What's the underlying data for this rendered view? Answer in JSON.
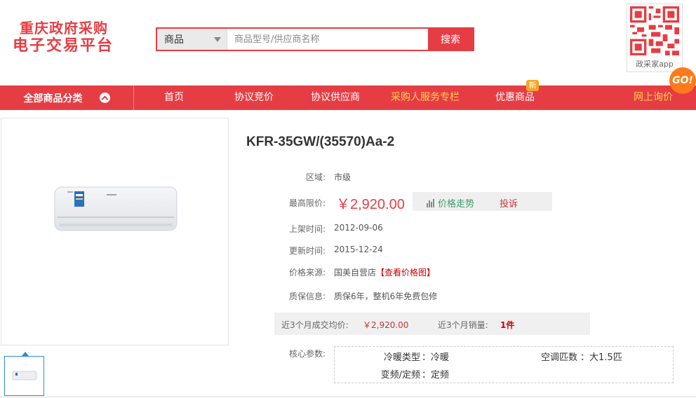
{
  "logo": {
    "line1": "重庆政府采购",
    "line2": "电子交易平台"
  },
  "search": {
    "category": "商品",
    "placeholder": "商品型号/供应商名称",
    "button": "搜索"
  },
  "qr": {
    "caption": "政采家app"
  },
  "nav": {
    "all_categories": "全部商品分类",
    "items": [
      "首页",
      "协议竞价",
      "协议供应商",
      "采购人服务专栏",
      "优惠商品",
      "网上询价"
    ],
    "new_badge": "新",
    "go_badge": "GO!"
  },
  "product": {
    "title": "KFR-35GW/(35570)Aa-2",
    "region_label": "区域:",
    "region": "市级",
    "max_price_label": "最高限价:",
    "max_price": "￥2,920.00",
    "price_trend": "价格走势",
    "complaint": "投诉",
    "listed_label": "上架时间:",
    "listed": "2012-09-06",
    "updated_label": "更新时间:",
    "updated": "2015-12-24",
    "source_label": "价格来源:",
    "source": "国美自营店",
    "source_link": "【查看价格图】",
    "warranty_label": "质保信息:",
    "warranty": "质保6年，整机6年免费包修",
    "avg_price_label": "近3个月成交均价:",
    "avg_price": "￥2,920.00",
    "sales_label": "近3个月销量:",
    "sales": "1件",
    "core_label": "核心参数:",
    "specs": [
      {
        "k": "冷暖类型",
        "v": "冷暖"
      },
      {
        "k": "空调匹数",
        "v": "大1.5匹"
      },
      {
        "k": "变频/定频",
        "v": "定频"
      }
    ]
  },
  "colors": {
    "brand_red": "#e63d44",
    "nav_highlight": "#ffd24d",
    "link_green": "#3a9a6a"
  }
}
